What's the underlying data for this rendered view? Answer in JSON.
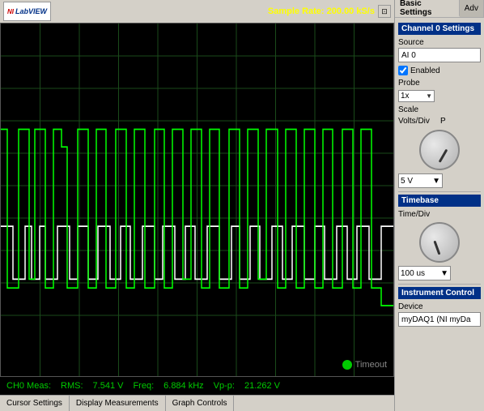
{
  "header": {
    "logo_ni": "NI",
    "logo_text": "LabVIEW",
    "sample_rate_label": "Sample Rate:",
    "sample_rate_value": "200.00 kS/s"
  },
  "scope": {
    "timeout_label": "Timeout"
  },
  "footer": {
    "ch0_label": "CH0 Meas:",
    "rms_label": "RMS:",
    "rms_value": "7.541 V",
    "freq_label": "Freq:",
    "freq_value": "6.884 kHz",
    "vpp_label": "Vp-p:",
    "vpp_value": "21.262 V"
  },
  "bottom_tabs": [
    {
      "label": "Cursor Settings"
    },
    {
      "label": "Display Measurements"
    },
    {
      "label": "Graph Controls"
    }
  ],
  "settings": {
    "tabs": [
      {
        "label": "Basic Settings",
        "active": true
      },
      {
        "label": "Adv",
        "active": false
      }
    ],
    "channel_section": "Channel 0 Settings",
    "source_label": "Source",
    "source_value": "AI 0",
    "enabled_label": "Enabled",
    "probe_label": "Probe",
    "probe_value": "1x",
    "scale_label": "Scale",
    "volts_div_label": "Volts/Div",
    "p_label": "P",
    "volt_value": "5 V",
    "timebase_section": "Timebase",
    "time_div_label": "Time/Div",
    "time_value": "100 us",
    "instrument_section": "Instrument Control",
    "device_label": "Device",
    "device_value": "myDAQ1 (NI myDa"
  }
}
